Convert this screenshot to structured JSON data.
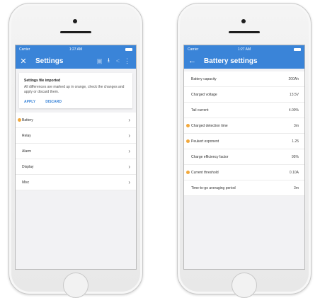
{
  "colors": {
    "accent": "#3a84d8",
    "changed_marker": "#f2a83b"
  },
  "left_phone": {
    "status": {
      "carrier": "Carrier",
      "time": "1:27 AM"
    },
    "appbar": {
      "title": "Settings",
      "close_icon": "close-icon",
      "icons": [
        "save-icon",
        "download-icon",
        "share-icon",
        "more-icon"
      ]
    },
    "notice": {
      "title": "Settings file imported",
      "message": "All differences are marked up in orange, check the changes and apply or discard them.",
      "apply_label": "APPLY",
      "discard_label": "DISCARD"
    },
    "menu": [
      {
        "label": "Battery",
        "changed": true
      },
      {
        "label": "Relay",
        "changed": false
      },
      {
        "label": "Alarm",
        "changed": false
      },
      {
        "label": "Display",
        "changed": false
      },
      {
        "label": "Misc",
        "changed": false
      }
    ]
  },
  "right_phone": {
    "status": {
      "carrier": "Carrier",
      "time": "1:27 AM"
    },
    "appbar": {
      "title": "Battery settings",
      "back_icon": "back-arrow-icon"
    },
    "settings": [
      {
        "label": "Battery capacity",
        "value": "200Ah",
        "changed": false
      },
      {
        "label": "Charged voltage",
        "value": "13.5V",
        "changed": false
      },
      {
        "label": "Tail current",
        "value": "4.00%",
        "changed": false
      },
      {
        "label": "Charged detection time",
        "value": "3m",
        "changed": true
      },
      {
        "label": "Peukert exponent",
        "value": "1.25",
        "changed": true
      },
      {
        "label": "Charge efficiency factor",
        "value": "95%",
        "changed": false
      },
      {
        "label": "Current threshold",
        "value": "0.10A",
        "changed": true
      },
      {
        "label": "Time-to-go averaging period",
        "value": "3m",
        "changed": false
      }
    ]
  }
}
